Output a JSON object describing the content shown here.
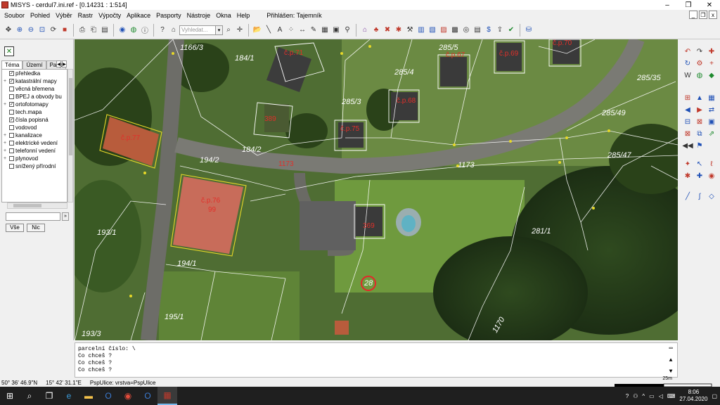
{
  "window": {
    "title": "MISYS - cerdul7.ini.ref - [0.14231 : 1:514]",
    "controls": [
      "–",
      "❐",
      "✕"
    ]
  },
  "menu": {
    "items": [
      "Soubor",
      "Pohled",
      "Výběr",
      "Rastr",
      "Výpočty",
      "Aplikace",
      "Pasporty",
      "Nástroje",
      "Okna",
      "Help"
    ],
    "login": "Přihlášen: Tajemník",
    "mdi": [
      "_",
      "❐",
      "x"
    ]
  },
  "toolbar": {
    "search_placeholder": "Vyhledat..."
  },
  "left_panel": {
    "tabs": [
      "Téma",
      "Území",
      "Pasp"
    ],
    "layers": [
      {
        "label": "přehledka",
        "checked": true,
        "expand": ""
      },
      {
        "label": "katastrální mapy",
        "checked": true,
        "expand": "+"
      },
      {
        "label": "věcná břemena",
        "checked": false,
        "expand": ""
      },
      {
        "label": "BPEJ a obvody bu",
        "checked": false,
        "expand": ""
      },
      {
        "label": "ortofotomapy",
        "checked": true,
        "expand": "+"
      },
      {
        "label": "tech.mapa",
        "checked": false,
        "expand": ""
      },
      {
        "label": "čísla popisná",
        "checked": true,
        "expand": ""
      },
      {
        "label": "vodovod",
        "checked": false,
        "expand": ""
      },
      {
        "label": "kanalizace",
        "checked": false,
        "expand": "+"
      },
      {
        "label": "elektrické vedení",
        "checked": false,
        "expand": "+"
      },
      {
        "label": "telefonní vedení",
        "checked": false,
        "expand": "+"
      },
      {
        "label": "plynovod",
        "checked": false,
        "expand": "+"
      },
      {
        "label": "snížený přírodní",
        "checked": false,
        "expand": ""
      }
    ],
    "btn_all": "Vše",
    "btn_none": "Nic"
  },
  "map": {
    "parcels": [
      "1166/3",
      "184/1",
      "285/5",
      "285/4",
      "285/35",
      "285/3",
      "285/49",
      "285/47",
      "184/2",
      "194/2",
      "1173",
      "193/1",
      "194/1",
      "281/1",
      "195/1",
      "193/3",
      "1170",
      "28"
    ],
    "buildings": [
      "č.p.71",
      "č.p.70",
      "č.p.67",
      "č.p.69",
      "č.p.68",
      "č.p.75",
      "č.p.77",
      "č.p.76",
      "389",
      "99",
      "1173",
      "369"
    ],
    "selected": "28"
  },
  "console": {
    "lines": [
      "parcelní číslo:  \\",
      "Co chceš ?",
      "Co chceš ?",
      "Co chceš ?"
    ]
  },
  "status": {
    "lat": "50° 36' 46.9\"N",
    "lon": "15° 42' 31.1\"E",
    "layer": "PspUlice: vrstva=PspUlice",
    "scale": "25m"
  },
  "taskbar": {
    "time": "8:06",
    "date": "27.04.2020"
  }
}
